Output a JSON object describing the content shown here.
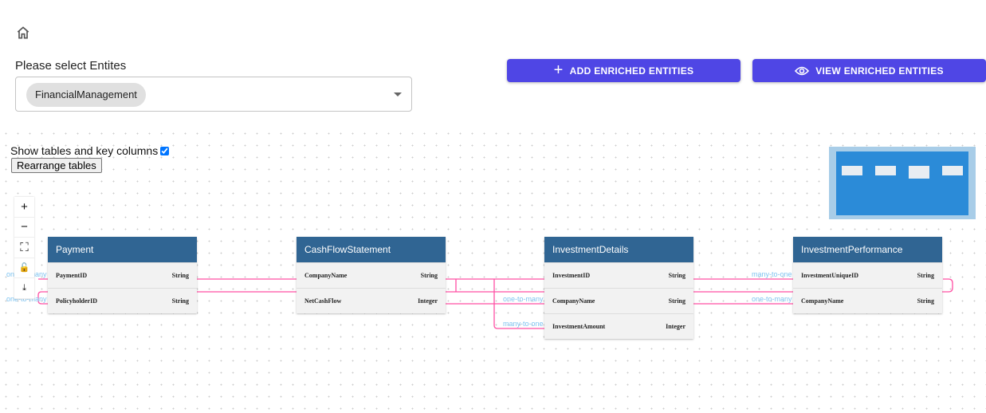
{
  "header": {
    "home_icon": "home-icon"
  },
  "select": {
    "label": "Please select Entites",
    "selected": "FinancialManagement"
  },
  "buttons": {
    "add": "ADD ENRICHED ENTITIES",
    "view": "VIEW ENRICHED ENTITIES"
  },
  "colors": {
    "button": "#4f46e5",
    "table_header": "#306593",
    "edge": "#ff4fa3",
    "edge_label": "#7ec3f0"
  },
  "diagram": {
    "show_label": "Show tables and key columns",
    "show_checked": true,
    "rearrange": "Rearrange tables",
    "controls": [
      "zoom-in",
      "zoom-out",
      "fit-view",
      "lock",
      "download"
    ],
    "tables": [
      {
        "name": "Payment",
        "rows": [
          [
            "PaymentID",
            "String"
          ],
          [
            "PolicyholderID",
            "String"
          ]
        ]
      },
      {
        "name": "CashFlowStatement",
        "rows": [
          [
            "CompanyName",
            "String"
          ],
          [
            "NetCashFlow",
            "Integer"
          ]
        ]
      },
      {
        "name": "InvestmentDetails",
        "rows": [
          [
            "InvestmentID",
            "String"
          ],
          [
            "CompanyName",
            "String"
          ],
          [
            "InvestmentAmount",
            "Integer"
          ]
        ]
      },
      {
        "name": "InvestmentPerformance",
        "rows": [
          [
            "InvestmentUniqueID",
            "String"
          ],
          [
            "CompanyName",
            "String"
          ]
        ]
      }
    ],
    "edge_labels": [
      "one-to-many",
      "one-to-many",
      "one-to-many",
      "many-to-one",
      "many-to-one",
      "one-to-many"
    ]
  }
}
